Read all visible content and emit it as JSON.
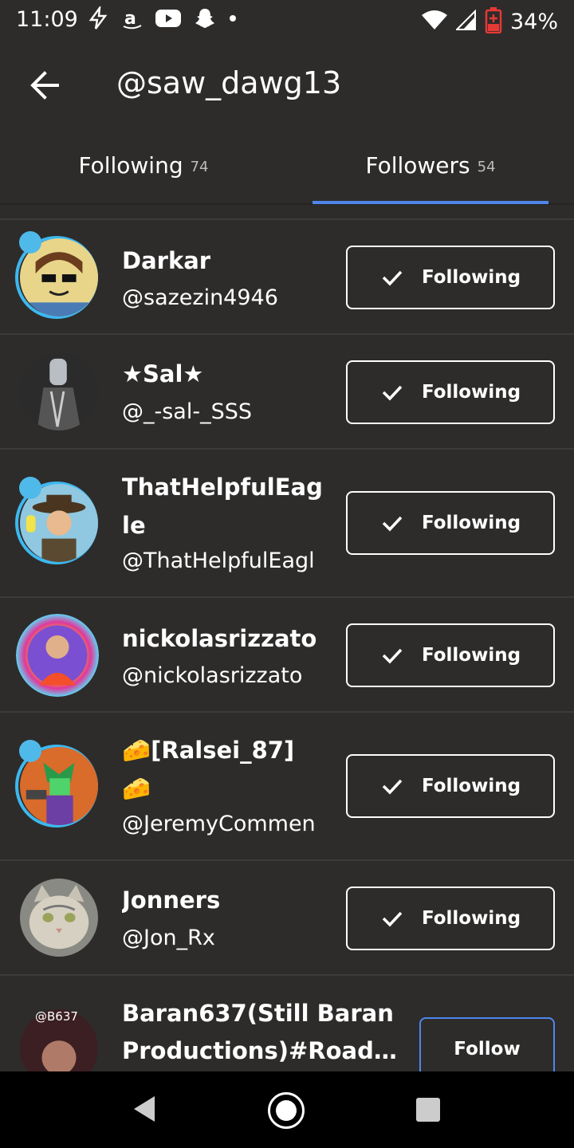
{
  "status_bar": {
    "time": "11:09",
    "battery": "34%",
    "icons": [
      "flash-icon",
      "amazon-icon",
      "youtube-icon",
      "snapchat-icon",
      "dot-icon",
      "wifi-icon",
      "signal-icon",
      "battery-icon"
    ]
  },
  "header": {
    "title": "@saw_dawg13"
  },
  "tabs": [
    {
      "label": "Following",
      "count": "74",
      "active": false
    },
    {
      "label": "Followers",
      "count": "54",
      "active": true
    }
  ],
  "followers": [
    {
      "name": "Darkar",
      "handle": "@sazezin4946",
      "button": "Following"
    },
    {
      "name": "★Sal★",
      "handle": "@_-sal-_SSS",
      "button": "Following"
    },
    {
      "name_line1": "ThatHelpfulEag",
      "name_line2": "le",
      "handle": "@ThatHelpfulEagl",
      "button": "Following"
    },
    {
      "name": "nickolasrizzato",
      "handle": "@nickolasrizzato",
      "button": "Following"
    },
    {
      "name_line1": "🧀[Ralsei_87]",
      "name_line2": "🧀",
      "handle": "@JeremyCommen",
      "button": "Following"
    },
    {
      "name": "Jonners",
      "handle": "@Jon_Rx",
      "button": "Following"
    },
    {
      "name_line1": "Baran637(Still Baran",
      "name_line2": "Productions)#Road…",
      "avatar_text": "@B637",
      "button": "Follow"
    }
  ],
  "colors": {
    "background": "#2d2c2b",
    "accent": "#4f86ec",
    "divider": "#3c3b3a",
    "nav_bar": "#000000"
  }
}
